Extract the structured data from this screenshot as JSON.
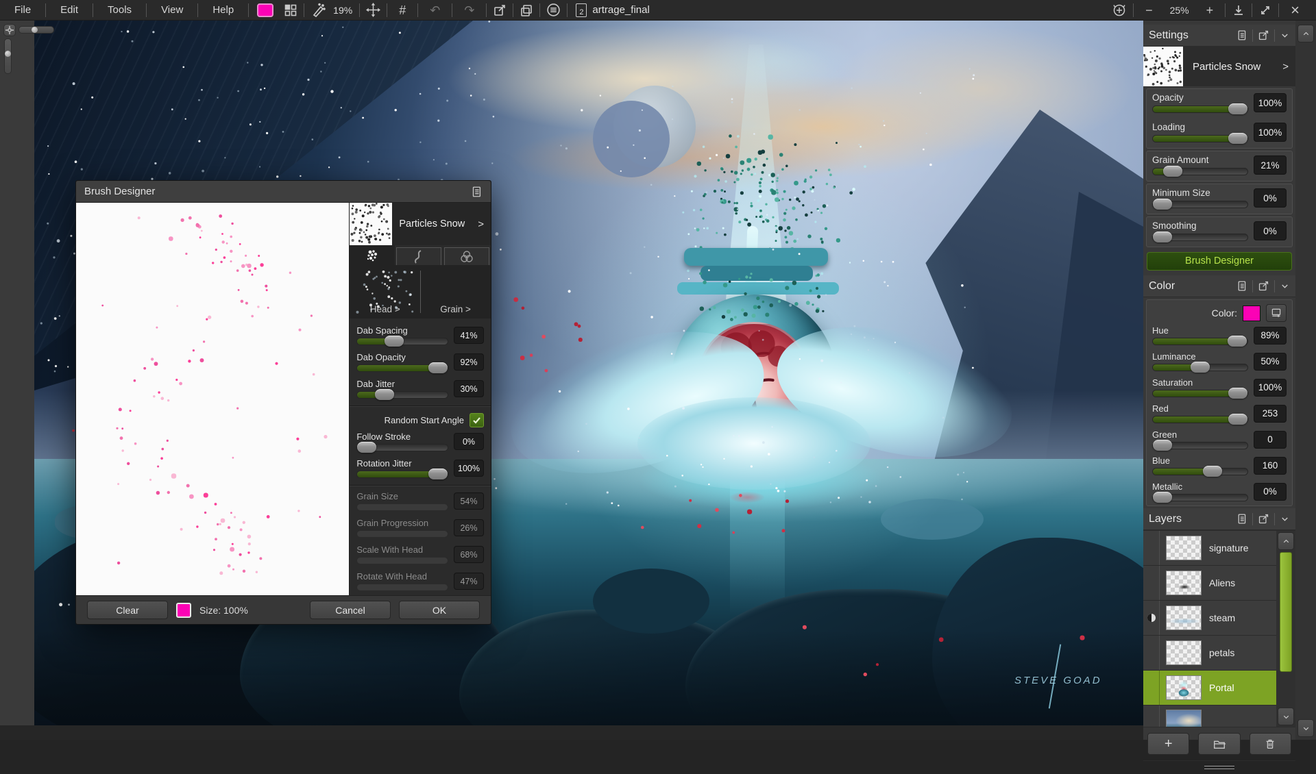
{
  "colors": {
    "accent_green": "#7da324",
    "slider_green": "#3c5a10",
    "pink": "#fb02b5"
  },
  "menubar": {
    "menus": [
      {
        "label": "File"
      },
      {
        "label": "Edit"
      },
      {
        "label": "Tools"
      },
      {
        "label": "View"
      },
      {
        "label": "Help"
      }
    ],
    "pressure": "19%",
    "hash_icon": "#",
    "undo_icon": "↶",
    "redo_icon": "↷",
    "doc_tab": {
      "badge": "2",
      "label": "artrage_final"
    },
    "zoom": {
      "minus": "−",
      "value": "25%",
      "plus": "+"
    },
    "close_icon": "×"
  },
  "canvas": {
    "signature": "Steve Goad"
  },
  "brush_designer": {
    "title": "Brush Designer",
    "brush_name": "Particles Snow",
    "brush_chevron": ">",
    "head_label": "Head >",
    "grain_label": "Grain >",
    "dab_sliders": [
      {
        "label": "Dab Spacing",
        "value": "41%",
        "pct": 41
      },
      {
        "label": "Dab Opacity",
        "value": "92%",
        "pct": 92
      },
      {
        "label": "Dab Jitter",
        "value": "30%",
        "pct": 30
      }
    ],
    "random_start_angle_label": "Random Start Angle",
    "stroke_sliders": [
      {
        "label": "Follow Stroke",
        "value": "0%",
        "pct": 0
      },
      {
        "label": "Rotation Jitter",
        "value": "100%",
        "pct": 100
      }
    ],
    "grain_sliders": [
      {
        "label": "Grain Size",
        "value": "54%"
      },
      {
        "label": "Grain Progression",
        "value": "26%"
      },
      {
        "label": "Scale With Head",
        "value": "68%"
      },
      {
        "label": "Rotate With Head",
        "value": "47%"
      }
    ],
    "footer": {
      "clear": "Clear",
      "size": "Size: 100%",
      "cancel": "Cancel",
      "ok": "OK"
    }
  },
  "settings_panel": {
    "title": "Settings",
    "brush_name": "Particles Snow",
    "brush_chevron": ">",
    "sliders": [
      {
        "label": "Opacity",
        "value": "100%",
        "pct": 100
      },
      {
        "label": "Loading",
        "value": "100%",
        "pct": 100
      },
      {
        "label": "Grain Amount",
        "value": "21%",
        "pct": 21
      },
      {
        "label": "Minimum Size",
        "value": "0%",
        "pct": 0
      },
      {
        "label": "Smoothing",
        "value": "0%",
        "pct": 0
      }
    ],
    "brush_designer_button": "Brush Designer"
  },
  "color_panel": {
    "title": "Color",
    "color_label": "Color:",
    "swatch_color": "#fb02b5",
    "sliders": [
      {
        "label": "Hue",
        "value": "89%",
        "pct": 89
      },
      {
        "label": "Luminance",
        "value": "50%",
        "pct": 50
      },
      {
        "label": "Saturation",
        "value": "100%",
        "pct": 100
      },
      {
        "label": "Red",
        "value": "253",
        "pct": 99
      },
      {
        "label": "Green",
        "value": "0",
        "pct": 0
      },
      {
        "label": "Blue",
        "value": "160",
        "pct": 63
      },
      {
        "label": "Metallic",
        "value": "0%",
        "pct": 0
      }
    ]
  },
  "layers_panel": {
    "title": "Layers",
    "layers": [
      {
        "name": "signature"
      },
      {
        "name": "Aliens"
      },
      {
        "name": "steam"
      },
      {
        "name": "petals"
      },
      {
        "name": "Portal"
      },
      {
        "name": ""
      }
    ]
  }
}
